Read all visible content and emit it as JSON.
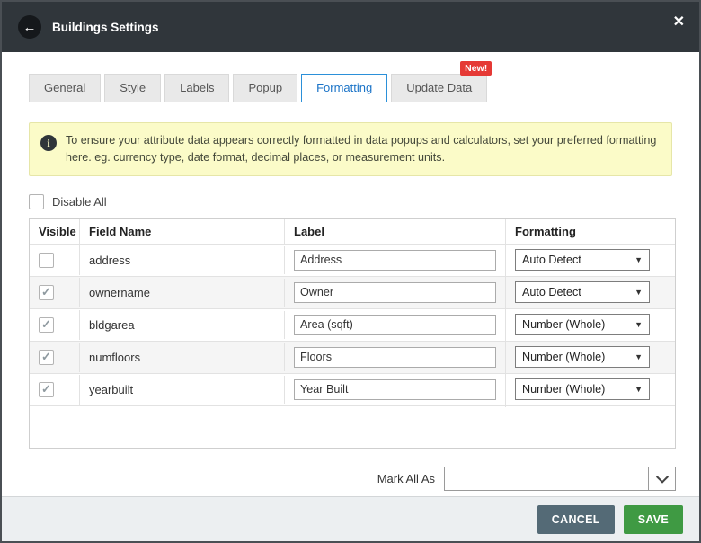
{
  "header": {
    "title": "Buildings Settings"
  },
  "tabs": [
    {
      "label": "General"
    },
    {
      "label": "Style"
    },
    {
      "label": "Labels"
    },
    {
      "label": "Popup"
    },
    {
      "label": "Formatting",
      "active": true
    },
    {
      "label": "Update Data",
      "badge": "New!"
    }
  ],
  "notice": {
    "text": "To ensure your attribute data appears correctly formatted in data popups and calculators, set your preferred formatting here. eg. currency type, date format, decimal places, or measurement units."
  },
  "disable_all": {
    "label": "Disable All",
    "checked": false
  },
  "table": {
    "headers": [
      "Visible",
      "Field Name",
      "Label",
      "Formatting"
    ],
    "rows": [
      {
        "visible": false,
        "field_name": "address",
        "label_value": "Address",
        "formatting": "Auto Detect"
      },
      {
        "visible": true,
        "field_name": "ownername",
        "label_value": "Owner",
        "formatting": "Auto Detect"
      },
      {
        "visible": true,
        "field_name": "bldgarea",
        "label_value": "Area (sqft)",
        "formatting": "Number (Whole)"
      },
      {
        "visible": true,
        "field_name": "numfloors",
        "label_value": "Floors",
        "formatting": "Number (Whole)"
      },
      {
        "visible": true,
        "field_name": "yearbuilt",
        "label_value": "Year Built",
        "formatting": "Number (Whole)"
      }
    ]
  },
  "mark_all": {
    "label": "Mark All As",
    "value": ""
  },
  "footer": {
    "cancel": "CANCEL",
    "save": "SAVE"
  },
  "icons": {
    "back": "←",
    "close": "✕",
    "info": "i",
    "check": "✓",
    "select_caret": "▼"
  },
  "colors": {
    "header_bg": "#30363b",
    "badge_red": "#e53935",
    "notice_bg": "#fbfbc8",
    "save_green": "#3f9a43",
    "cancel_slate": "#546a76",
    "tab_active_blue": "#2b90d9"
  }
}
